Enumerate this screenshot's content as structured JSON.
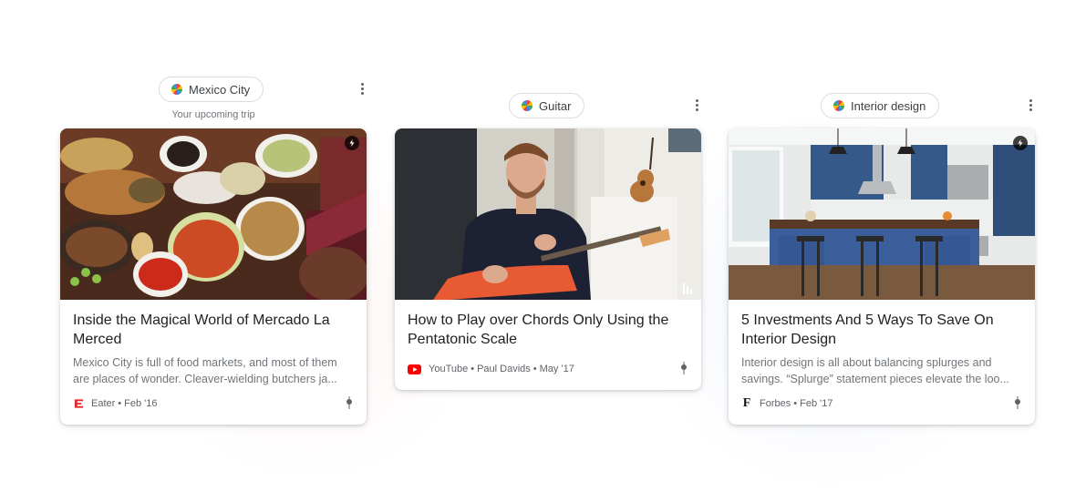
{
  "cards": [
    {
      "topic": "Mexico City",
      "subtitle": "Your upcoming trip",
      "title_lines": [
        "Inside the Magical World of Mercado La",
        "Merced"
      ],
      "snippet_lines": [
        "Mexico City is full of food markets, and most of them",
        "are places of wonder. Cleaver-wielding butchers ja..."
      ],
      "source": "Eater",
      "date": "Feb '16",
      "source_logo": "eater-logo-icon",
      "badge": "amp-bolt-icon"
    },
    {
      "topic": "Guitar",
      "title_lines": [
        "How to Play over Chords Only Using the",
        "Pentatonic Scale"
      ],
      "source": "YouTube",
      "author": "Paul Davids",
      "date": "May '17",
      "source_logo": "youtube-logo-icon",
      "badge": "video-bars-icon"
    },
    {
      "topic": "Interior design",
      "title_lines": [
        "5 Investments And 5 Ways To Save On",
        "Interior Design"
      ],
      "snippet_lines": [
        "Interior design is all about balancing splurges and",
        "savings. “Splurge” statement pieces elevate the loo..."
      ],
      "source": "Forbes",
      "date": "Feb '17",
      "source_logo": "forbes-logo-icon",
      "badge": "amp-bolt-icon"
    }
  ],
  "separator": "•",
  "colors": {
    "youtube_red": "#ff0000",
    "eater_red": "#e6252c",
    "chip_border": "#dadce0",
    "muted_text": "#70757a"
  }
}
